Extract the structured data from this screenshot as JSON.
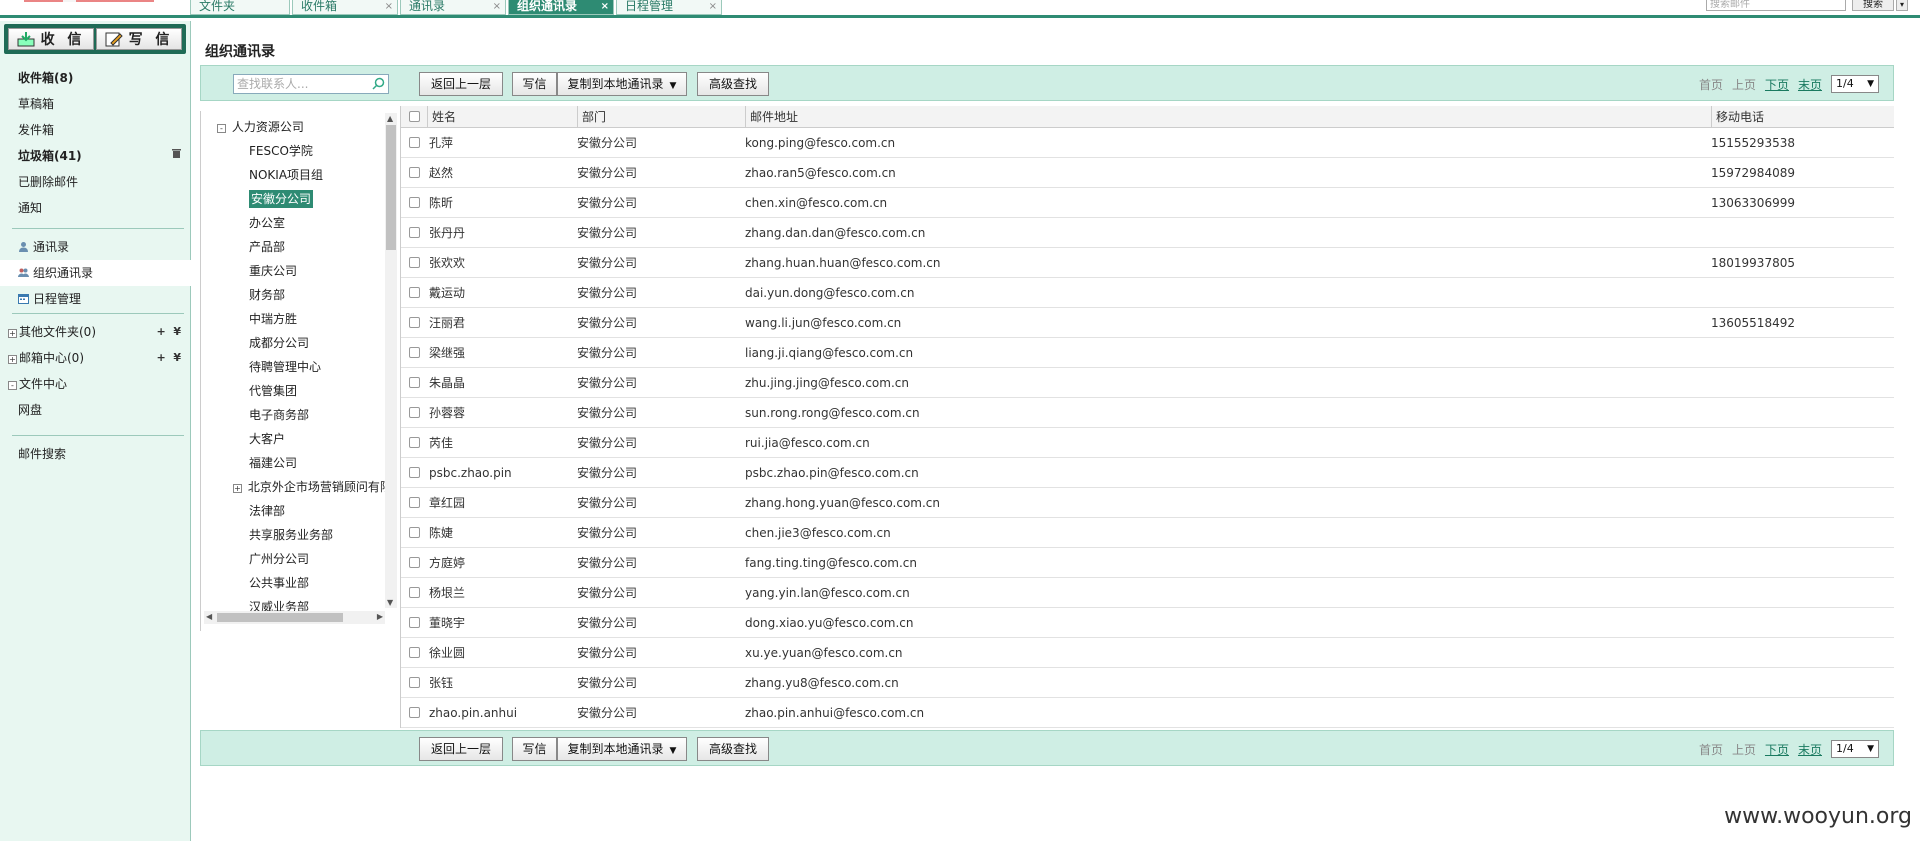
{
  "tabs": [
    {
      "label": "文件夹",
      "active": false,
      "closable": false
    },
    {
      "label": "收件箱",
      "active": false,
      "closable": true
    },
    {
      "label": "通讯录",
      "active": false,
      "closable": true
    },
    {
      "label": "组织通讯录",
      "active": true,
      "closable": true
    },
    {
      "label": "日程管理",
      "active": false,
      "closable": true
    }
  ],
  "top_search": {
    "placeholder": "搜索邮件",
    "button": "搜索"
  },
  "sidebar": {
    "receive_label": "收 信",
    "write_label": "写 信",
    "mail_items": [
      {
        "label": "收件箱(8)",
        "bold": true
      },
      {
        "label": "草稿箱",
        "bold": false
      },
      {
        "label": "发件箱",
        "bold": false
      },
      {
        "label": "垃圾箱(41)",
        "bold": true,
        "trash": true
      },
      {
        "label": "已删除邮件",
        "bold": false
      },
      {
        "label": "通知",
        "bold": false
      }
    ],
    "contact_items": [
      {
        "label": "通讯录",
        "icon": "contacts-icon"
      },
      {
        "label": "组织通讯录",
        "icon": "org-contacts-icon",
        "selected": true
      },
      {
        "label": "日程管理",
        "icon": "calendar-icon"
      }
    ],
    "folder_items": [
      {
        "label": "其他文件夹(0)",
        "expander": "+",
        "actions": true
      },
      {
        "label": "邮箱中心(0)",
        "expander": "+",
        "actions": true
      },
      {
        "label": "文件中心",
        "expander": "-",
        "actions": false
      },
      {
        "label": "网盘",
        "expander": "",
        "actions": false
      }
    ],
    "search_label": "邮件搜索"
  },
  "main": {
    "title": "组织通讯录",
    "contact_search_placeholder": "查找联系人...",
    "toolbar": {
      "back": "返回上一层",
      "write": "写信",
      "copy": "复制到本地通讯录",
      "advanced": "高级查找"
    },
    "pager": {
      "first": "首页",
      "prev": "上页",
      "next": "下页",
      "last": "末页",
      "page": "1/4"
    },
    "tree": {
      "root": "人力资源公司",
      "children": [
        {
          "label": "FESCO学院"
        },
        {
          "label": "NOKIA项目组"
        },
        {
          "label": "安徽分公司",
          "selected": true
        },
        {
          "label": "办公室"
        },
        {
          "label": "产品部"
        },
        {
          "label": "重庆公司"
        },
        {
          "label": "财务部"
        },
        {
          "label": "中瑞方胜"
        },
        {
          "label": "成都分公司"
        },
        {
          "label": "待聘管理中心"
        },
        {
          "label": "代管集团"
        },
        {
          "label": "电子商务部"
        },
        {
          "label": "大客户"
        },
        {
          "label": "福建公司"
        },
        {
          "label": "北京外企市场营销顾问有限",
          "expandable": true
        },
        {
          "label": "法律部"
        },
        {
          "label": "共享服务业务部"
        },
        {
          "label": "广州分公司"
        },
        {
          "label": "公共事业部"
        },
        {
          "label": "汉威业务部"
        }
      ]
    },
    "columns": [
      "姓名",
      "部门",
      "邮件地址",
      "移动电话"
    ],
    "rows": [
      [
        "孔萍",
        "安徽分公司",
        "kong.ping@fesco.com.cn",
        "15155293538"
      ],
      [
        "赵然",
        "安徽分公司",
        "zhao.ran5@fesco.com.cn",
        "15972984089"
      ],
      [
        "陈昕",
        "安徽分公司",
        "chen.xin@fesco.com.cn",
        "13063306999"
      ],
      [
        "张丹丹",
        "安徽分公司",
        "zhang.dan.dan@fesco.com.cn",
        ""
      ],
      [
        "张欢欢",
        "安徽分公司",
        "zhang.huan.huan@fesco.com.cn",
        "18019937805"
      ],
      [
        "戴运动",
        "安徽分公司",
        "dai.yun.dong@fesco.com.cn",
        ""
      ],
      [
        "汪丽君",
        "安徽分公司",
        "wang.li.jun@fesco.com.cn",
        "13605518492"
      ],
      [
        "梁继强",
        "安徽分公司",
        "liang.ji.qiang@fesco.com.cn",
        ""
      ],
      [
        "朱晶晶",
        "安徽分公司",
        "zhu.jing.jing@fesco.com.cn",
        ""
      ],
      [
        "孙蓉蓉",
        "安徽分公司",
        "sun.rong.rong@fesco.com.cn",
        ""
      ],
      [
        "芮佳",
        "安徽分公司",
        "rui.jia@fesco.com.cn",
        ""
      ],
      [
        "psbc.zhao.pin",
        "安徽分公司",
        "psbc.zhao.pin@fesco.com.cn",
        ""
      ],
      [
        "章红园",
        "安徽分公司",
        "zhang.hong.yuan@fesco.com.cn",
        ""
      ],
      [
        "陈婕",
        "安徽分公司",
        "chen.jie3@fesco.com.cn",
        ""
      ],
      [
        "方庭婷",
        "安徽分公司",
        "fang.ting.ting@fesco.com.cn",
        ""
      ],
      [
        "杨垠兰",
        "安徽分公司",
        "yang.yin.lan@fesco.com.cn",
        ""
      ],
      [
        "董晓宇",
        "安徽分公司",
        "dong.xiao.yu@fesco.com.cn",
        ""
      ],
      [
        "徐业圆",
        "安徽分公司",
        "xu.ye.yuan@fesco.com.cn",
        ""
      ],
      [
        "张钰",
        "安徽分公司",
        "zhang.yu8@fesco.com.cn",
        ""
      ],
      [
        "zhao.pin.anhui",
        "安徽分公司",
        "zhao.pin.anhui@fesco.com.cn",
        ""
      ]
    ]
  },
  "watermark": "www.wooyun.org"
}
